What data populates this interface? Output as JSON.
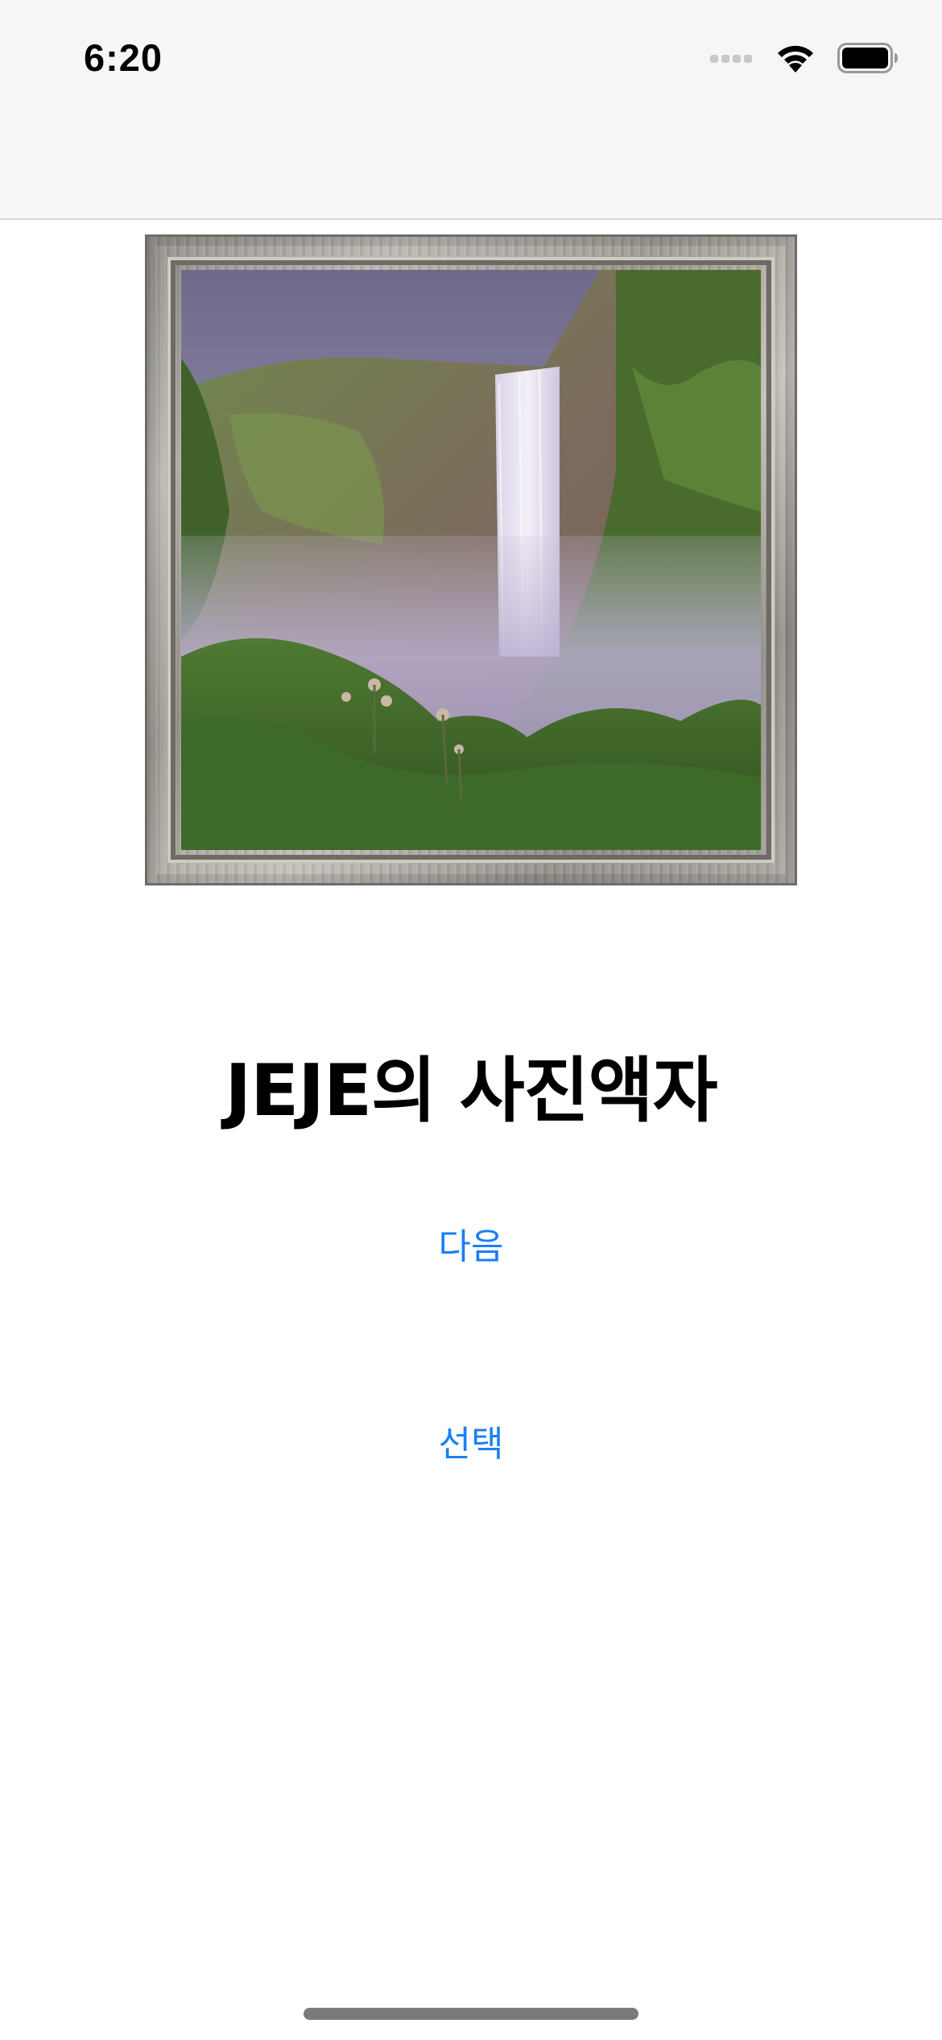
{
  "status_bar": {
    "time": "6:20",
    "icons": [
      "cellular-signal-icon",
      "wifi-icon",
      "battery-icon"
    ]
  },
  "photo_frame": {
    "image": "waterfall-photo",
    "frame": "weathered-wood-frame"
  },
  "main": {
    "title": "JEJE의 사진액자",
    "next_label": "다음",
    "select_label": "선택"
  },
  "colors": {
    "accent": "#1a7ff5",
    "nav_background": "#f6f6f6",
    "background": "#ffffff",
    "text": "#000000"
  }
}
